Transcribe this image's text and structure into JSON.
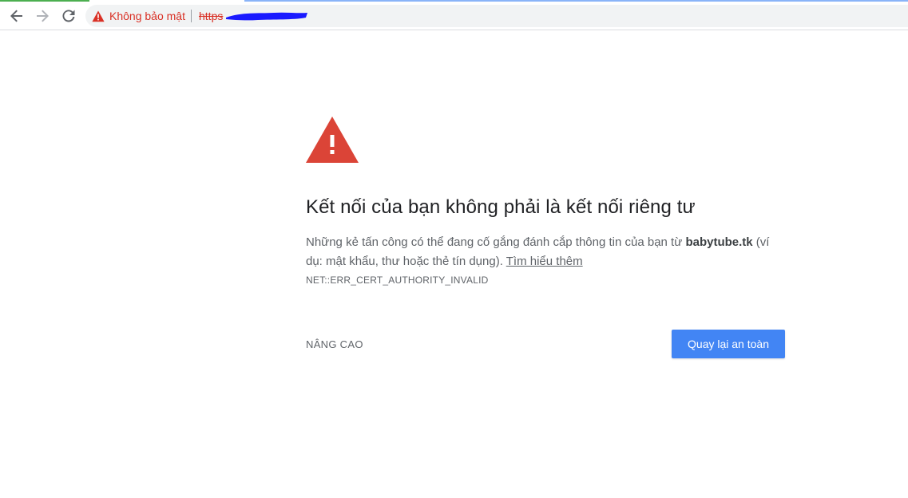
{
  "toolbar": {
    "security_label": "Không bảo mật",
    "url_visible": "https",
    "icons": {
      "back": "back-arrow-icon",
      "forward": "forward-arrow-icon",
      "reload": "reload-icon",
      "security": "warning-triangle-icon"
    }
  },
  "interstitial": {
    "heading": "Kết nối của bạn không phải là kết nối riêng tư",
    "message_prefix": "Những kẻ tấn công có thể đang cố gắng đánh cắp thông tin của bạn từ ",
    "domain": "babytube.tk",
    "message_suffix": " (ví dụ: mật khẩu, thư hoặc thẻ tín dụng). ",
    "learn_more": "Tìm hiểu thêm",
    "error_code": "NET::ERR_CERT_AUTHORITY_INVALID",
    "advanced_label": "NÂNG CAO",
    "back_to_safety_label": "Quay lại an toàn",
    "icon": "danger-triangle-icon"
  },
  "colors": {
    "danger": "#d93025",
    "primary_button": "#4285f4",
    "text": "#5f6368",
    "heading": "#202124"
  }
}
